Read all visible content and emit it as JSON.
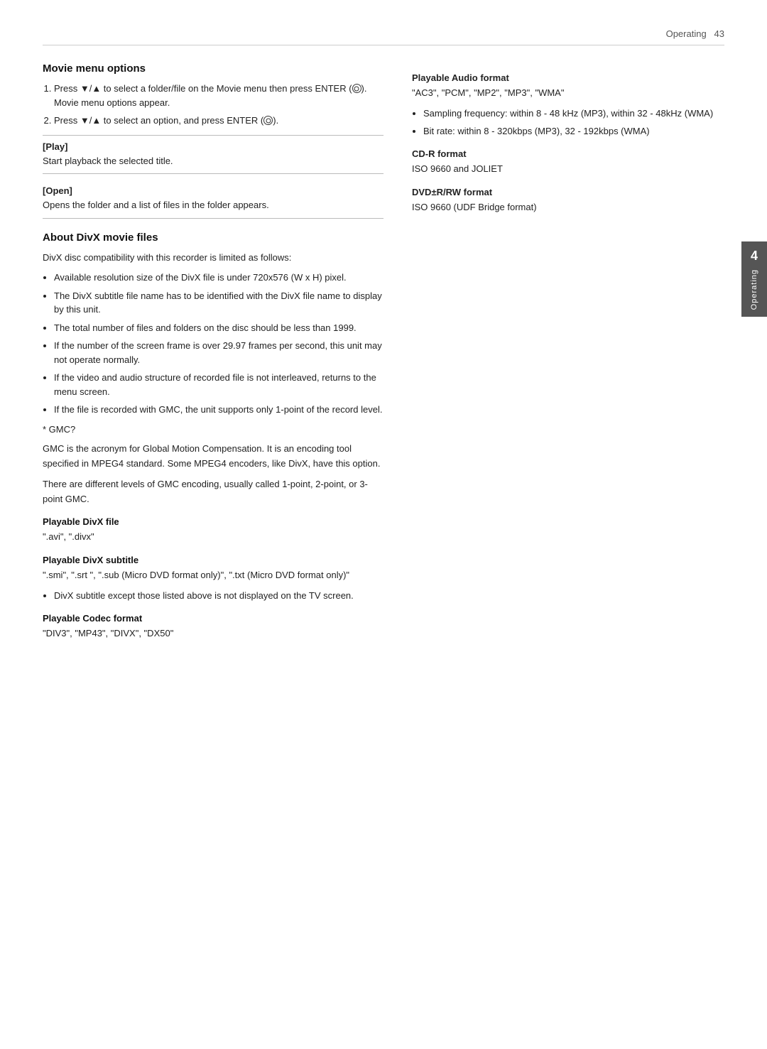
{
  "header": {
    "text": "Operating",
    "page_number": "43"
  },
  "side_tab": {
    "number": "4",
    "label": "Operating"
  },
  "left_column": {
    "movie_menu_section": {
      "title": "Movie menu options",
      "steps": [
        {
          "text": "Press ▼/▲ to select a folder/file on the Movie menu then press ENTER (●). Movie menu options appear."
        },
        {
          "text": "Press ▼/▲ to select an option, and press ENTER (●)."
        }
      ],
      "play_label": "[Play]",
      "play_desc": "Start playback the selected title.",
      "open_label": "[Open]",
      "open_desc": "Opens the folder and a list of files in the folder appears."
    },
    "divx_section": {
      "title": "About DivX movie files",
      "intro": "DivX disc compatibility with this recorder is limited as follows:",
      "bullets": [
        "Available resolution size of the DivX file is under 720x576 (W x H) pixel.",
        "The DivX subtitle file name has to be identified with the DivX file name to display by this unit.",
        "The total number of files and folders on the disc should be less than 1999.",
        "If the number of the screen frame is over 29.97 frames per second, this unit may not operate normally.",
        "If the video and audio structure of recorded file is not interleaved, returns to the menu screen.",
        "If the file is recorded with GMC, the unit supports only 1-point of the record level."
      ],
      "gmc_note": "* GMC?",
      "gmc_desc1": "GMC is the acronym for Global Motion Compensation. It is an encoding tool specified in MPEG4 standard. Some MPEG4 encoders, like DivX, have this option.",
      "gmc_desc2": "There are different levels of GMC encoding, usually called 1-point, 2-point, or 3-point GMC.",
      "playable_divx_file_label": "Playable DivX file",
      "playable_divx_file_value": "\".avi\", \".divx\"",
      "playable_divx_subtitle_label": "Playable DivX subtitle",
      "playable_divx_subtitle_value": "\".smi\", \".srt \", \".sub (Micro DVD format only)\", \".txt (Micro DVD format only)\"",
      "divx_subtitle_bullet": "DivX subtitle except those listed above is not displayed on the TV screen.",
      "playable_codec_label": "Playable Codec format",
      "playable_codec_value": "\"DIV3\", \"MP43\", \"DIVX\", \"DX50\""
    }
  },
  "right_column": {
    "playable_audio_label": "Playable Audio format",
    "playable_audio_value": "\"AC3\", \"PCM\", \"MP2\", \"MP3\", \"WMA\"",
    "audio_bullets": [
      "Sampling frequency: within 8 - 48 kHz (MP3), within 32 - 48kHz (WMA)",
      "Bit rate: within 8 - 320kbps (MP3), 32 - 192kbps (WMA)"
    ],
    "cd_r_label": "CD-R format",
    "cd_r_value": "ISO 9660 and JOLIET",
    "dvd_label": "DVD±R/RW format",
    "dvd_value": "ISO 9660 (UDF Bridge format)"
  }
}
